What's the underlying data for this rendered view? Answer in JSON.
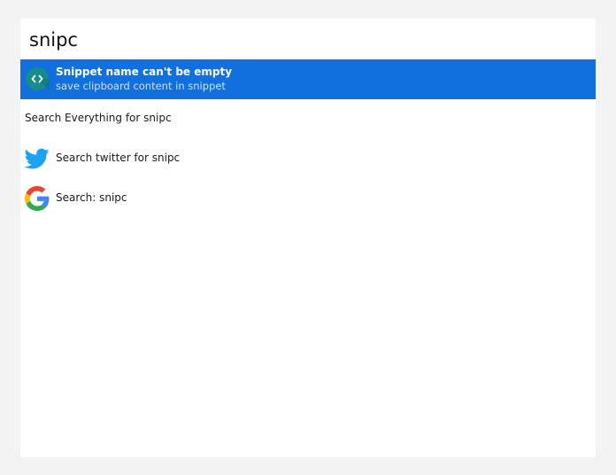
{
  "search": {
    "value": "snipc"
  },
  "results": [
    {
      "title": "Snippet name can't be empty",
      "subtitle": "save clipboard content in snippet",
      "icon": "code-snippet-icon",
      "selected": true
    },
    {
      "title": "Search Everything for snipc",
      "icon": "",
      "selected": false
    },
    {
      "title": "Search twitter for snipc",
      "icon": "twitter-bird-icon",
      "selected": false
    },
    {
      "title": "Search: snipc",
      "icon": "google-g-icon",
      "selected": false
    }
  ],
  "colors": {
    "selection": "#1170dd",
    "snippet_icon": "#178c8a",
    "twitter": "#1da1f2",
    "background": "#f3f3f3"
  }
}
